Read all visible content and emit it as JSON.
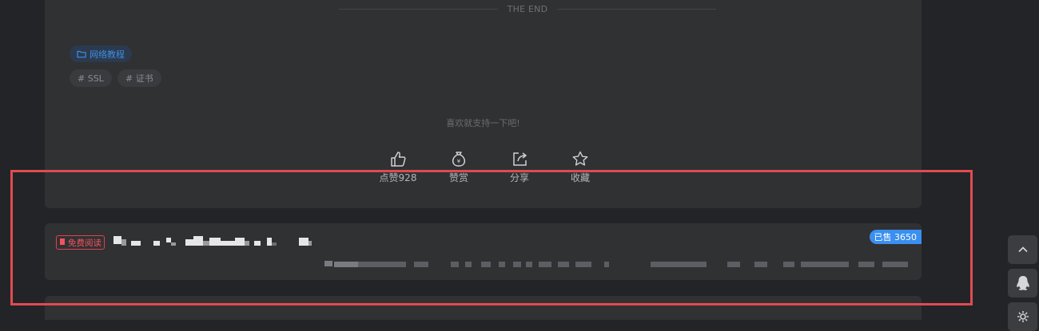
{
  "article_footer": {
    "end_text": "THE END",
    "category_label": "网络教程",
    "tags": [
      "# SSL",
      "# 证书"
    ],
    "support_text": "喜欢就支持一下吧!",
    "actions": [
      {
        "icon": "thumbs-up-icon",
        "label": "点赞928"
      },
      {
        "icon": "money-bag-icon",
        "label": "赞赏"
      },
      {
        "icon": "share-icon",
        "label": "分享"
      },
      {
        "icon": "star-icon",
        "label": "收藏"
      }
    ]
  },
  "product_card": {
    "badge_label": "免费阅读",
    "sold_label": "已售 3650",
    "title_obscured": true,
    "description_obscured": true
  },
  "side_buttons": [
    {
      "icon": "chevron-up-icon"
    },
    {
      "icon": "qq-penguin-icon"
    },
    {
      "icon": "gear-icon"
    }
  ],
  "colors": {
    "page_bg": "#232427",
    "card_bg": "#303133",
    "accent_blue": "#3a8ff0",
    "badge_red": "#e0424d",
    "highlight_red": "#e04b52"
  }
}
